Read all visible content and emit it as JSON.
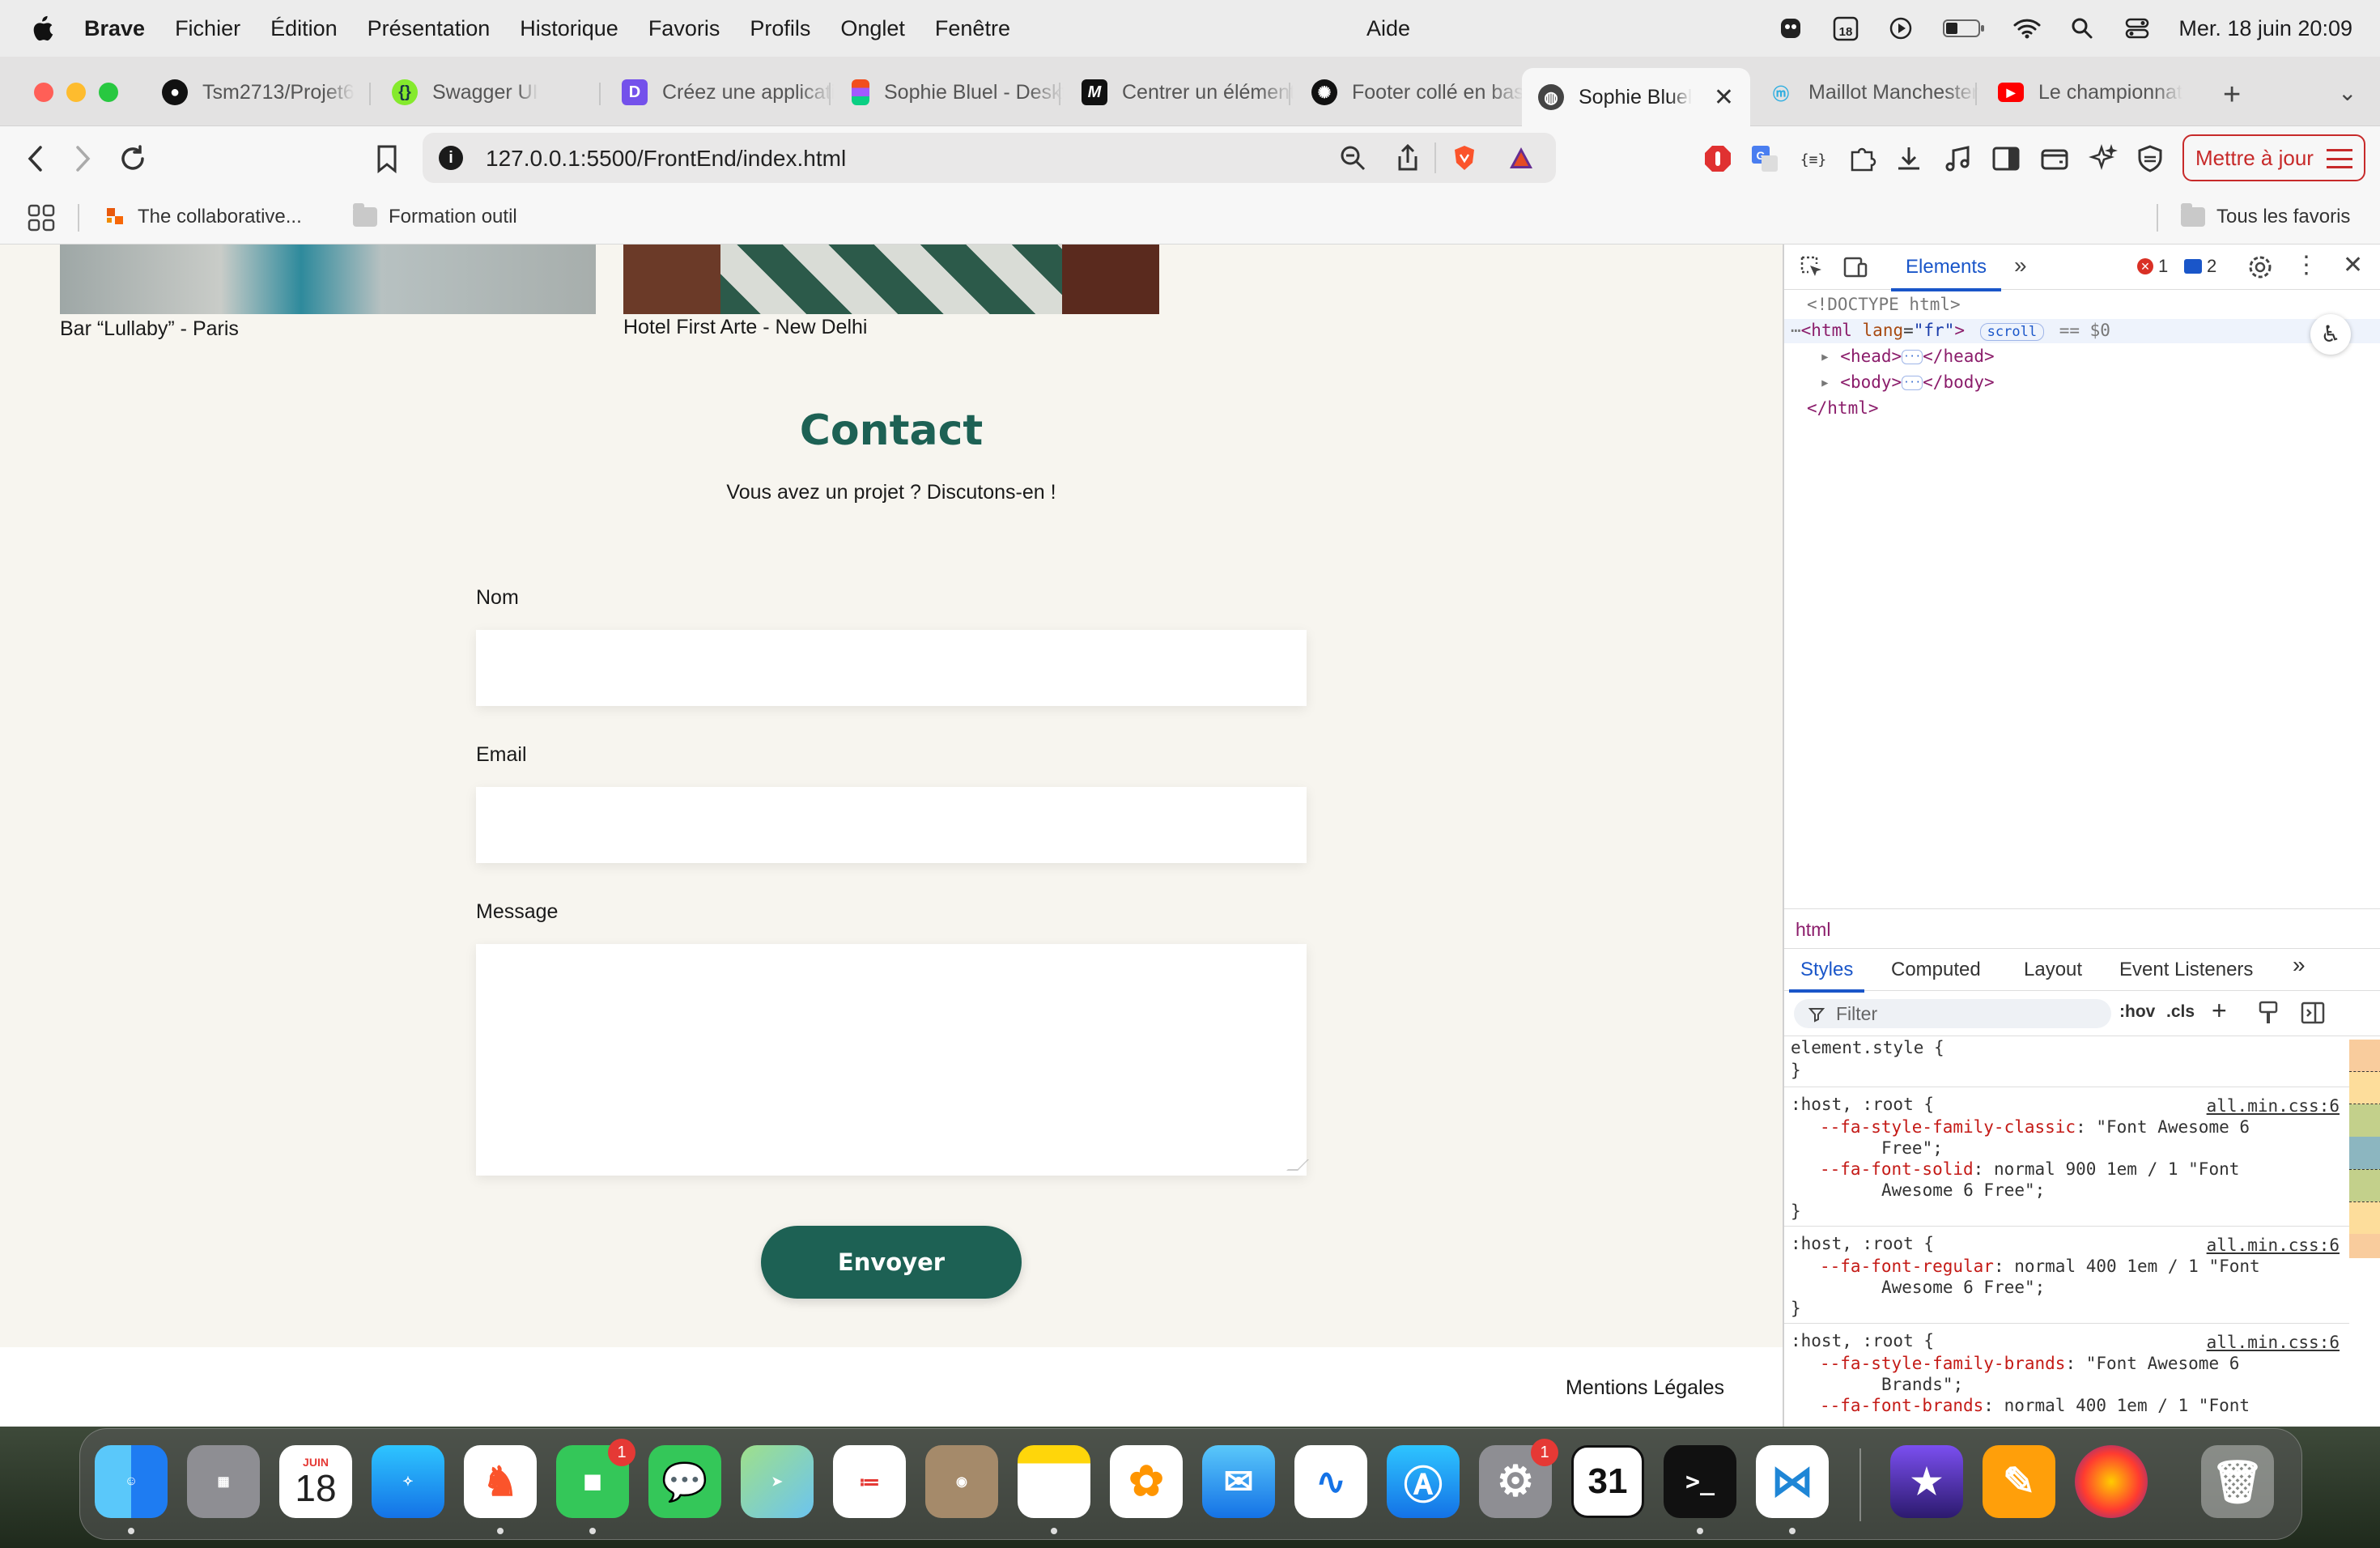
{
  "menubar": {
    "app": "Brave",
    "items": [
      "Fichier",
      "Édition",
      "Présentation",
      "Historique",
      "Favoris",
      "Profils",
      "Onglet",
      "Fenêtre"
    ],
    "help": "Aide",
    "calendar_day": "18",
    "clock": "Mer. 18 juin  20:09"
  },
  "tabs": [
    {
      "label": "Tsm2713/Projet6",
      "icon": "github-icon"
    },
    {
      "label": "Swagger UI",
      "icon": "swagger-icon"
    },
    {
      "label": "Créez une application",
      "icon": "openclassrooms-icon"
    },
    {
      "label": "Sophie Bluel - Desktop",
      "icon": "figma-icon"
    },
    {
      "label": "Centrer un élément",
      "icon": "medium-icon"
    },
    {
      "label": "Footer collé en bas",
      "icon": "chatgpt-icon"
    },
    {
      "label": "Sophie Bluel",
      "icon": "globe-icon",
      "active": true
    },
    {
      "label": "Maillot Manchester",
      "icon": "om-icon"
    },
    {
      "label": "Le championnat",
      "icon": "youtube-icon"
    }
  ],
  "toolbar": {
    "url": "127.0.0.1:5500/FrontEnd/index.html",
    "update_label": "Mettre à jour"
  },
  "bookmarks": {
    "items": [
      "The collaborative...",
      "Formation outil"
    ],
    "all": "Tous les favoris"
  },
  "page": {
    "captions": [
      "Bar “Lullaby” - Paris",
      "Hotel First Arte - New Delhi"
    ],
    "contact_title": "Contact",
    "contact_subtitle": "Vous avez un projet ? Discutons-en !",
    "labels": {
      "name": "Nom",
      "email": "Email",
      "message": "Message"
    },
    "submit": "Envoyer",
    "footer_link": "Mentions Légales"
  },
  "devtools": {
    "tab_elements": "Elements",
    "error_count": "1",
    "message_count": "2",
    "dom": {
      "doctype": "<!DOCTYPE html>",
      "html_open": "<html",
      "lang_attr": "lang",
      "lang_val": "\"fr\"",
      "gt": ">",
      "scroll_pill": "scroll",
      "selected_marker": "== $0",
      "head": "<head>",
      "head_close": "</head>",
      "body": "<body>",
      "body_close": "</body>",
      "html_close": "</html>"
    },
    "breadcrumb": "html",
    "style_tabs": [
      "Styles",
      "Computed",
      "Layout",
      "Event Listeners"
    ],
    "filter_placeholder": "Filter",
    "hov": ":hov",
    "cls": ".cls",
    "rules": {
      "element_style": "element.style {",
      "close": "}",
      "host_root": ":host, :root {",
      "src": "all.min.css:6",
      "r1_p1_name": "--fa-style-family-classic",
      "r1_p1_val": ": \"Font Awesome 6",
      "r1_p1_cont": "Free\";",
      "r1_p2_name": "--fa-font-solid",
      "r1_p2_val": ": normal 900 1em / 1 \"Font",
      "r1_p2_cont": "Awesome 6 Free\";",
      "r2_p1_name": "--fa-font-regular",
      "r2_p1_val": ": normal 400 1em / 1 \"Font",
      "r2_p1_cont": "Awesome 6 Free\";",
      "r3_p1_name": "--fa-style-family-brands",
      "r3_p1_val": ": \"Font Awesome 6",
      "r3_p1_cont": "Brands\";",
      "r3_p2_name": "--fa-font-brands",
      "r3_p2_val": ": normal 400 1em / 1 \"Font"
    }
  },
  "dock": {
    "calendar_month": "JUIN",
    "calendar_day": "18",
    "facetime_badge": "1",
    "settings_badge": "1",
    "fantastical_day": "31"
  },
  "colors": {
    "accent": "#1d6154",
    "page_bg": "#f7f5ef",
    "devtools_blue": "#1a56c9",
    "update_red": "#c72a2a"
  }
}
